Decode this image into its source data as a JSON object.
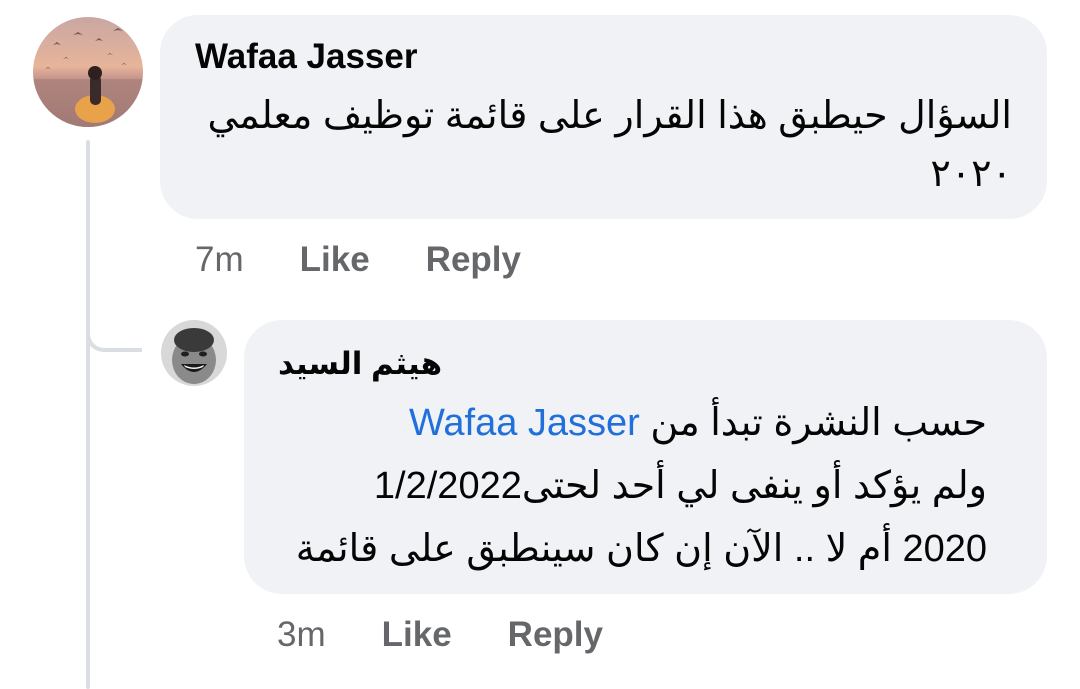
{
  "comments": [
    {
      "author": "Wafaa Jasser",
      "avatar_icon": "profile-photo-sunset",
      "text_lines": [
        "السؤال حيطبق هذا القرار على قائمة توظيف معلمي",
        "٢٠٢٠"
      ],
      "time": "7m",
      "like_label": "Like",
      "reply_label": "Reply"
    },
    {
      "author": "هيثم السيد",
      "avatar_icon": "profile-photo-child",
      "line1_text": "حسب النشرة تبدأ من",
      "mention": "Wafaa Jasser",
      "line2_text": "ولم يؤكد أو ينفى لي أحد لحتى1/2/2022",
      "line3_text": "2020 أم لا .. الآن إن كان سينطبق على قائمة",
      "time": "3m",
      "like_label": "Like",
      "reply_label": "Reply"
    }
  ],
  "colors": {
    "bubble": "#f0f2f5",
    "mention": "#216fdb",
    "meta": "#65676b",
    "thread_line": "#dadde1"
  }
}
